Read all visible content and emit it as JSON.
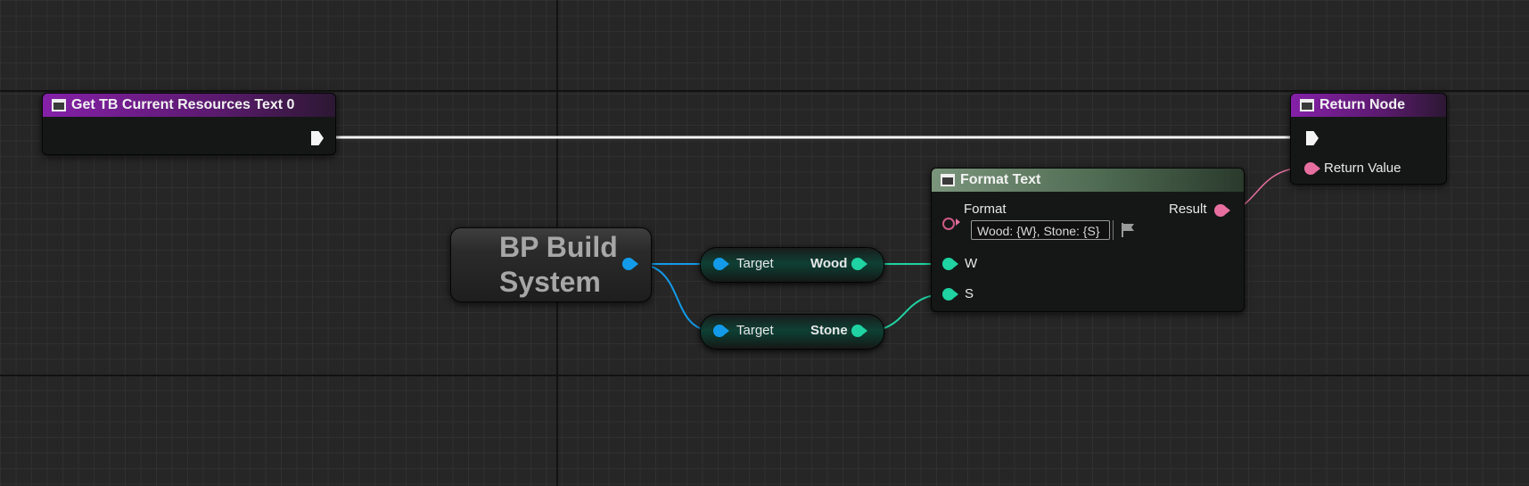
{
  "nodes": {
    "entry": {
      "title": "Get TB Current Resources Text 0",
      "icon": "function-icon"
    },
    "return": {
      "title": "Return Node",
      "icon": "function-icon",
      "return_value_label": "Return Value"
    },
    "format_text": {
      "title": "Format Text",
      "icon": "function-icon",
      "format_label": "Format",
      "format_value": "Wood: {W}, Stone: {S}",
      "result_label": "Result",
      "w_label": "W",
      "s_label": "S"
    },
    "build_system": {
      "title": "BP Build System"
    },
    "get_wood": {
      "target_label": "Target",
      "output_label": "Wood"
    },
    "get_stone": {
      "target_label": "Target",
      "output_label": "Stone"
    }
  },
  "colors": {
    "background": "#262626",
    "exec_wire": "#f5f5f5",
    "text_pin": "#e76fa0",
    "int_pin": "#1fd3a3",
    "object_pin": "#139bea",
    "function_header": "#8520a8",
    "pure_header": "#7a957b"
  }
}
